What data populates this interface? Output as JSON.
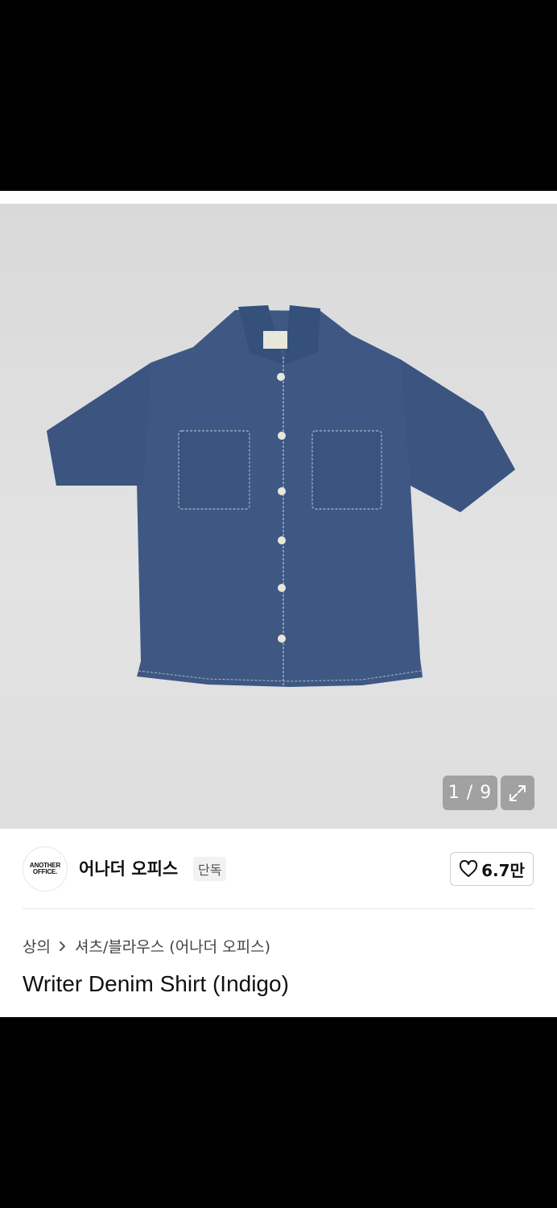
{
  "gallery": {
    "counter": "1 / 9",
    "expand_icon": "expand-icon",
    "image_subject": "indigo denim short-sleeve shirt"
  },
  "brand": {
    "logo_line1": "ANOTHER",
    "logo_line2": "OFFICE.",
    "name": "어나더 오피스",
    "badge": "단독"
  },
  "like": {
    "icon": "heart-outline-icon",
    "count": "6.7만"
  },
  "breadcrumb": {
    "level1": "상의",
    "separator_icon": "chevron-right-icon",
    "level2": "셔츠/블라우스 (어나더 오피스)"
  },
  "product": {
    "title": "Writer Denim Shirt (Indigo)"
  },
  "colors": {
    "denim": "#3f5a85",
    "background": "#dedede",
    "text": "#111111"
  }
}
